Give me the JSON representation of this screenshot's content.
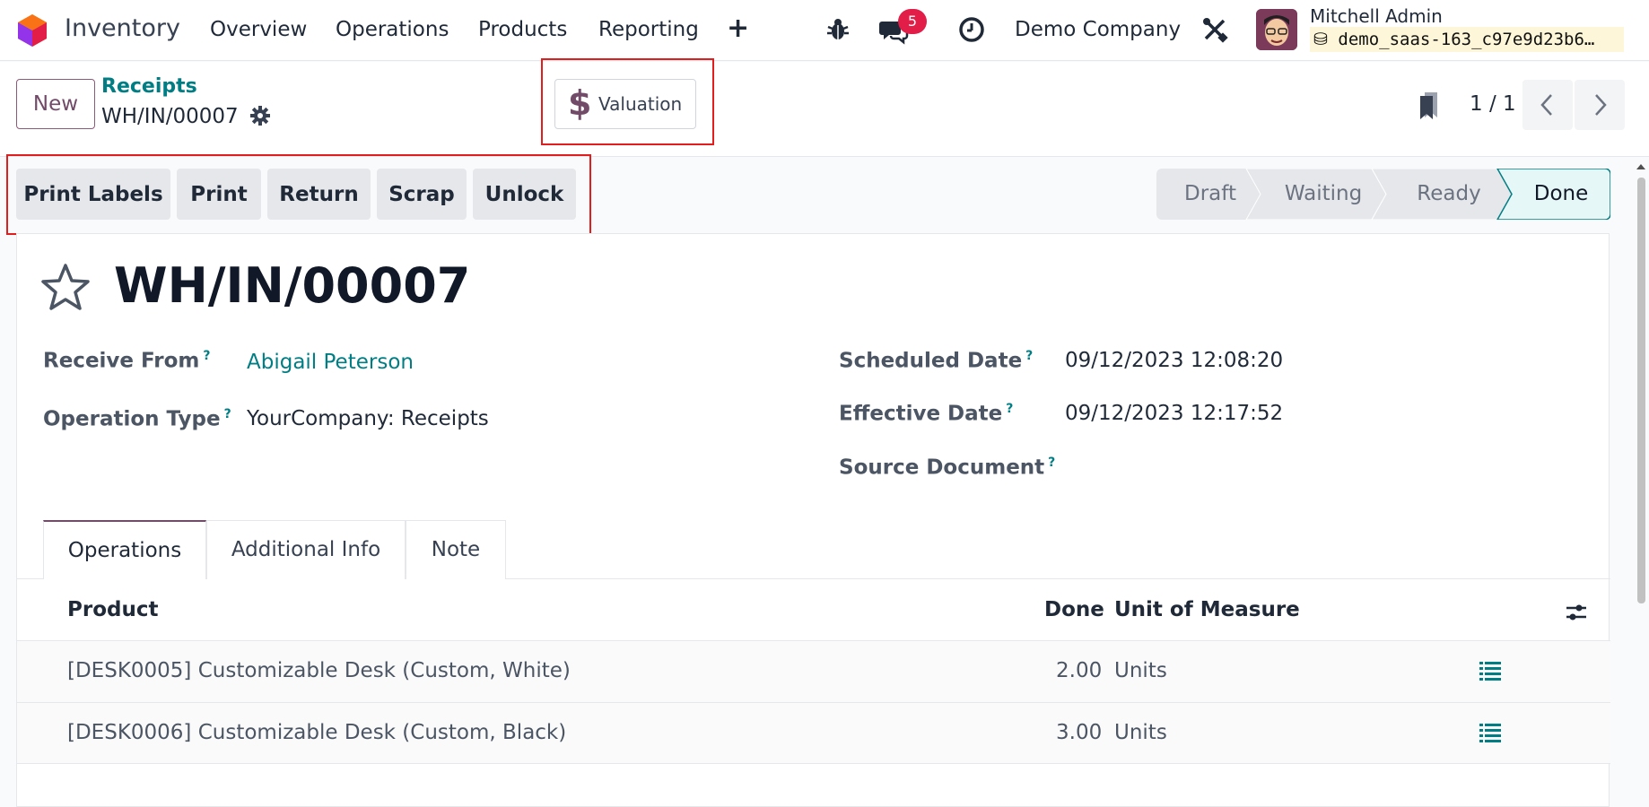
{
  "nav": {
    "app_name": "Inventory",
    "menu": [
      "Overview",
      "Operations",
      "Products",
      "Reporting"
    ],
    "plus": "+",
    "chat_badge": "5",
    "company": "Demo Company",
    "user_name": "Mitchell Admin",
    "database": "demo_saas-163_c97e9d23b6…"
  },
  "control": {
    "new_label": "New",
    "breadcrumb": "Receipts",
    "record": "WH/IN/00007",
    "valuation_label": "Valuation",
    "pager": "1 / 1"
  },
  "actions": [
    "Print Labels",
    "Print",
    "Return",
    "Scrap",
    "Unlock"
  ],
  "stages": [
    "Draft",
    "Waiting",
    "Ready",
    "Done"
  ],
  "active_stage": "Done",
  "form": {
    "title": "WH/IN/00007",
    "receive_from_label": "Receive From",
    "receive_from": "Abigail Peterson",
    "operation_type_label": "Operation Type",
    "operation_type": "YourCompany: Receipts",
    "scheduled_label": "Scheduled Date",
    "scheduled": "09/12/2023 12:08:20",
    "effective_label": "Effective Date",
    "effective": "09/12/2023 12:17:52",
    "source_label": "Source Document",
    "help": "?"
  },
  "tabs": [
    "Operations",
    "Additional Info",
    "Note"
  ],
  "table": {
    "headers": {
      "product": "Product",
      "done": "Done",
      "uom": "Unit of Measure"
    },
    "rows": [
      {
        "product": "[DESK0005] Customizable Desk (Custom, White)",
        "done": "2.00",
        "uom": "Units"
      },
      {
        "product": "[DESK0006] Customizable Desk (Custom, Black)",
        "done": "3.00",
        "uom": "Units"
      }
    ]
  },
  "colors": {
    "brand": "#714b67",
    "link": "#017e84",
    "highlight": "#e11d1d",
    "badge": "#e11d48"
  }
}
